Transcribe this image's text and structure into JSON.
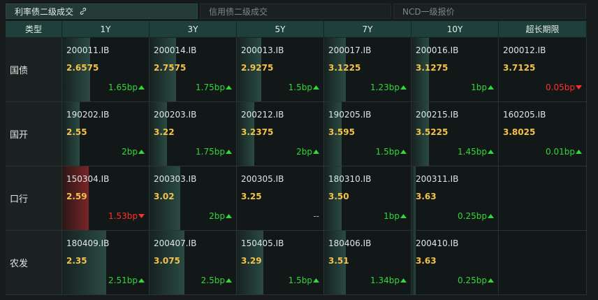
{
  "tabs": [
    {
      "label": "利率债二级成交",
      "active": true
    },
    {
      "label": "信用债二级成交",
      "active": false
    },
    {
      "label": "NCD一级报价",
      "active": false
    }
  ],
  "headers": [
    "类型",
    "1Y",
    "3Y",
    "5Y",
    "7Y",
    "10Y",
    "超长期限"
  ],
  "rows": [
    {
      "type": "国债",
      "cells": [
        {
          "code": "200011.IB",
          "yield": "2.6575",
          "change": "1.65bp",
          "dir": "up",
          "level": 0.32
        },
        {
          "code": "200014.IB",
          "yield": "2.7575",
          "change": "1.75bp",
          "dir": "up",
          "level": 0.3
        },
        {
          "code": "200013.IB",
          "yield": "2.9275",
          "change": "1.5bp",
          "dir": "up",
          "level": 0.28
        },
        {
          "code": "200017.IB",
          "yield": "3.1225",
          "change": "1.23bp",
          "dir": "up",
          "level": 0.25
        },
        {
          "code": "200016.IB",
          "yield": "3.1275",
          "change": "1bp",
          "dir": "up",
          "level": 0.2
        },
        {
          "code": "200012.IB",
          "yield": "3.7125",
          "change": "0.05bp",
          "dir": "down",
          "level": 0
        }
      ]
    },
    {
      "type": "国开",
      "cells": [
        {
          "code": "190202.IB",
          "yield": "2.55",
          "change": "2bp",
          "dir": "up",
          "level": 0.2
        },
        {
          "code": "200203.IB",
          "yield": "3.22",
          "change": "1.75bp",
          "dir": "up",
          "level": 0.2
        },
        {
          "code": "200212.IB",
          "yield": "3.2375",
          "change": "2bp",
          "dir": "up",
          "level": 0.2
        },
        {
          "code": "190205.IB",
          "yield": "3.595",
          "change": "1.5bp",
          "dir": "up",
          "level": 0.2
        },
        {
          "code": "200215.IB",
          "yield": "3.5225",
          "change": "1.45bp",
          "dir": "up",
          "level": 0.2
        },
        {
          "code": "160205.IB",
          "yield": "3.8025",
          "change": "0.01bp",
          "dir": "up",
          "level": 0
        }
      ]
    },
    {
      "type": "口行",
      "cells": [
        {
          "code": "150304.IB",
          "yield": "2.59",
          "change": "1.53bp",
          "dir": "down",
          "level": 0.3
        },
        {
          "code": "200303.IB",
          "yield": "3.02",
          "change": "2bp",
          "dir": "up",
          "level": 0.35
        },
        {
          "code": "200305.IB",
          "yield": "3.25",
          "change": "--",
          "dir": "none",
          "level": 0
        },
        {
          "code": "180310.IB",
          "yield": "3.50",
          "change": "1bp",
          "dir": "up",
          "level": 0.2
        },
        {
          "code": "200311.IB",
          "yield": "3.63",
          "change": "0.25bp",
          "dir": "up",
          "level": 0.05
        },
        null
      ]
    },
    {
      "type": "农发",
      "cells": [
        {
          "code": "180409.IB",
          "yield": "2.35",
          "change": "2.51bp",
          "dir": "up",
          "level": 0.5
        },
        {
          "code": "200407.IB",
          "yield": "3.075",
          "change": "2.5bp",
          "dir": "up",
          "level": 0.4
        },
        {
          "code": "150405.IB",
          "yield": "3.29",
          "change": "1.5bp",
          "dir": "up",
          "level": 0.3
        },
        {
          "code": "180406.IB",
          "yield": "3.51",
          "change": "1.34bp",
          "dir": "up",
          "level": 0.25
        },
        {
          "code": "200410.IB",
          "yield": "3.63",
          "change": "0.25bp",
          "dir": "up",
          "level": 0.05
        },
        null
      ]
    }
  ],
  "colors": {
    "up": "#33d63c",
    "down": "#ff2f2f",
    "yield": "#f3c24a",
    "header": "#1f403a"
  },
  "icons": {
    "tab_link": "link-icon",
    "up": "triangle-up-icon",
    "down": "triangle-down-icon"
  }
}
